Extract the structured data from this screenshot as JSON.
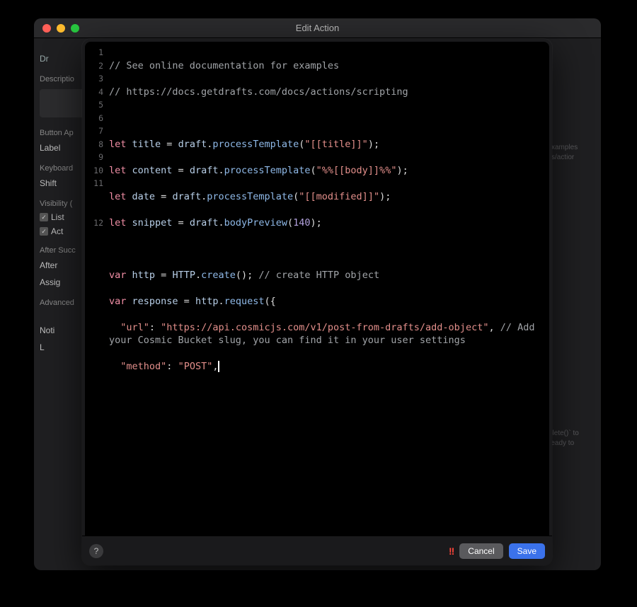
{
  "window": {
    "title": "Edit Action"
  },
  "sidebar": {
    "top_label": "Dr",
    "description_label": "Descriptio",
    "button_ap_label": "Button Ap",
    "label_text": "Label",
    "keyboard_label": "Keyboard",
    "shift_label": "Shift",
    "visibility_label": "Visibility (",
    "list_label": "List",
    "act_label": "Act",
    "after_success_label": "After Succ",
    "after_text": "After",
    "assig_text": "Assig",
    "advanced_label": "Advanced",
    "noti_text": "Noti",
    "l_text": "L"
  },
  "right_hints": {
    "top1": "xamples",
    "top2": "s/actior",
    "bot1": "plete()` to",
    "bot2": "ready to"
  },
  "editor": {
    "lines": {
      "l1": {
        "text": "// See online documentation for examples"
      },
      "l2": {
        "text": "// https://docs.getdrafts.com/docs/actions/scripting"
      },
      "l4": {
        "kw": "let",
        "id": " title ",
        "eq": "= ",
        "obj": "draft",
        "dot": ".",
        "fn": "processTemplate",
        "op": "(",
        "str": "\"[[title]]\"",
        "cp": ");"
      },
      "l5": {
        "kw": "let",
        "id": " content ",
        "eq": "= ",
        "obj": "draft",
        "dot": ".",
        "fn": "processTemplate",
        "op": "(",
        "str": "\"%%[[body]]%%\"",
        "cp": ");"
      },
      "l6": {
        "kw": "let",
        "id": " date ",
        "eq": "= ",
        "obj": "draft",
        "dot": ".",
        "fn": "processTemplate",
        "op": "(",
        "str": "\"[[modified]]\"",
        "cp": ");"
      },
      "l7": {
        "kw": "let",
        "id": " snippet ",
        "eq": "= ",
        "obj": "draft",
        "dot": ".",
        "fn": "bodyPreview",
        "op": "(",
        "num": "140",
        "cp": ");"
      },
      "l9": {
        "kw": "var",
        "id": " http ",
        "eq": "= ",
        "obj": "HTTP",
        "dot": ".",
        "fn": "create",
        "op": "(); ",
        "cmt": "// create HTTP object"
      },
      "l10": {
        "kw": "var",
        "id": " response ",
        "eq": "= ",
        "obj": "http",
        "dot": ".",
        "fn": "request",
        "op": "({"
      },
      "l11": {
        "key": "\"url\"",
        "colon": ": ",
        "val": "\"https://api.cosmicjs.com/v1/post-from-drafts/add-object\"",
        "comma": ", ",
        "cmt": "// Add your Cosmic Bucket slug, you can find it in your user settings"
      },
      "l12": {
        "key": "\"method\"",
        "colon": ": ",
        "val": "\"POST\"",
        "trail": ","
      }
    },
    "line_numbers": [
      "1",
      "2",
      "3",
      "4",
      "5",
      "6",
      "7",
      "8",
      "9",
      "10",
      "11",
      "12"
    ]
  },
  "footer": {
    "help": "?",
    "warn": "!!",
    "cancel": "Cancel",
    "save": "Save"
  }
}
